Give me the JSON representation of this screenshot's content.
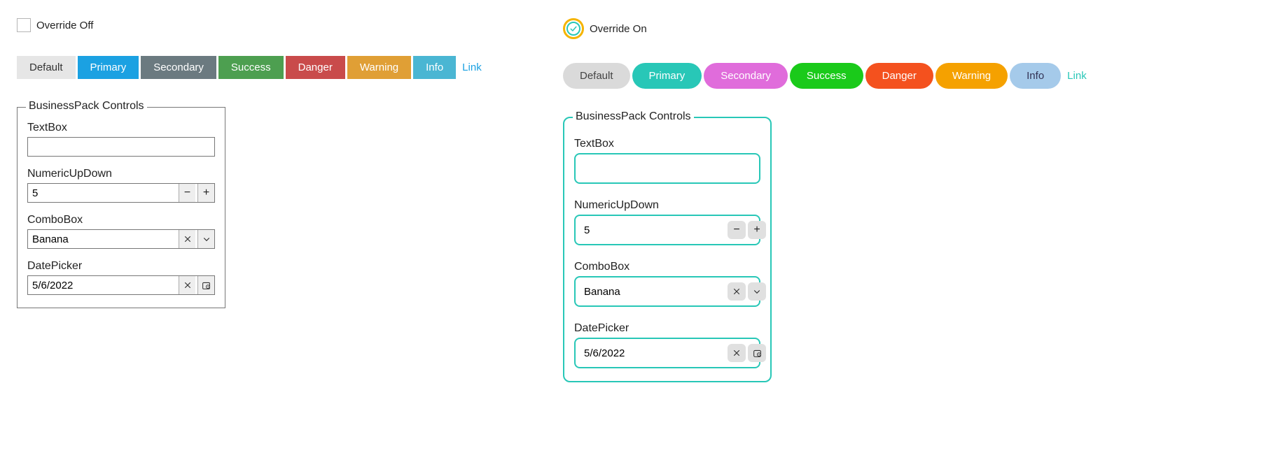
{
  "left": {
    "checkboxLabel": "Override Off",
    "buttons": {
      "default": "Default",
      "primary": "Primary",
      "secondary": "Secondary",
      "success": "Success",
      "danger": "Danger",
      "warning": "Warning",
      "info": "Info",
      "link": "Link"
    },
    "group": {
      "legend": "BusinessPack Controls",
      "textbox": {
        "label": "TextBox",
        "value": ""
      },
      "numeric": {
        "label": "NumericUpDown",
        "value": "5"
      },
      "combo": {
        "label": "ComboBox",
        "value": "Banana"
      },
      "date": {
        "label": "DatePicker",
        "value": "5/6/2022"
      }
    }
  },
  "right": {
    "checkboxLabel": "Override On",
    "buttons": {
      "default": "Default",
      "primary": "Primary",
      "secondary": "Secondary",
      "success": "Success",
      "danger": "Danger",
      "warning": "Warning",
      "info": "Info",
      "link": "Link"
    },
    "group": {
      "legend": "BusinessPack Controls",
      "textbox": {
        "label": "TextBox",
        "value": ""
      },
      "numeric": {
        "label": "NumericUpDown",
        "value": "5"
      },
      "combo": {
        "label": "ComboBox",
        "value": "Banana"
      },
      "date": {
        "label": "DatePicker",
        "value": "5/6/2022"
      }
    }
  }
}
